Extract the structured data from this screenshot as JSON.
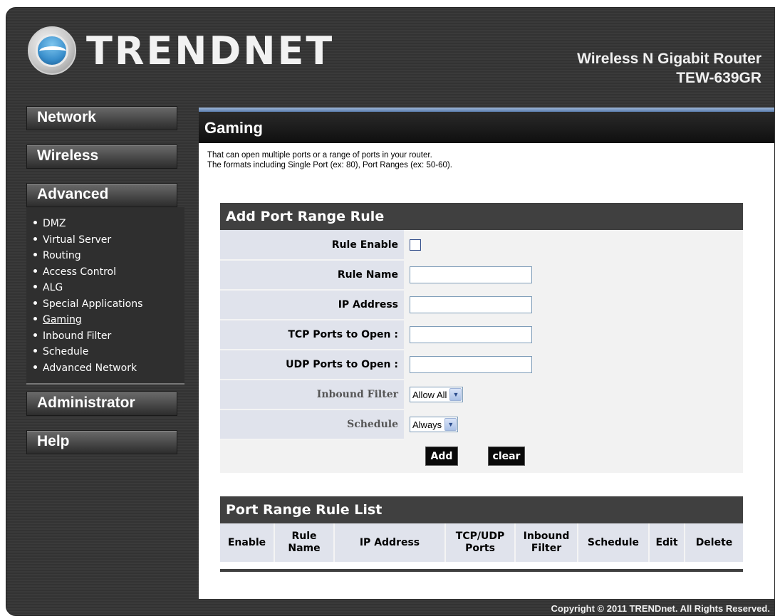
{
  "header": {
    "brand": "TRENDNET",
    "product_line1": "Wireless N Gigabit Router",
    "product_line2": "TEW-639GR"
  },
  "sidebar": {
    "network": "Network",
    "wireless": "Wireless",
    "advanced": "Advanced",
    "advanced_items": [
      {
        "label": "DMZ"
      },
      {
        "label": "Virtual Server"
      },
      {
        "label": "Routing"
      },
      {
        "label": "Access Control"
      },
      {
        "label": "ALG"
      },
      {
        "label": "Special Applications"
      },
      {
        "label": "Gaming"
      },
      {
        "label": "Inbound Filter"
      },
      {
        "label": "Schedule"
      },
      {
        "label": "Advanced Network"
      }
    ],
    "active_item": "Gaming",
    "administrator": "Administrator",
    "help": "Help"
  },
  "page": {
    "title": "Gaming",
    "desc_line1": "That can open multiple ports or a range of ports in your router.",
    "desc_line2": "The formats including Single Port (ex: 80), Port Ranges (ex: 50-60)."
  },
  "add_rule": {
    "heading": "Add Port Range Rule",
    "rule_enable_label": "Rule Enable",
    "rule_enable_checked": false,
    "rule_name_label": "Rule Name",
    "rule_name_value": "",
    "ip_address_label": "IP Address",
    "ip_address_value": "",
    "tcp_ports_label": "TCP Ports to Open :",
    "tcp_ports_value": "",
    "udp_ports_label": "UDP Ports to Open :",
    "udp_ports_value": "",
    "inbound_filter_label": "Inbound Filter",
    "inbound_filter_selected": "Allow All",
    "schedule_label": "Schedule",
    "schedule_selected": "Always",
    "add_button": "Add",
    "clear_button": "clear"
  },
  "rule_list": {
    "heading": "Port Range Rule List",
    "columns": [
      "Enable",
      "Rule Name",
      "IP Address",
      "TCP/UDP Ports",
      "Inbound Filter",
      "Schedule",
      "Edit",
      "Delete"
    ],
    "rows": []
  },
  "footer": {
    "copyright": "Copyright © 2011 TRENDnet. All Rights Reserved."
  }
}
